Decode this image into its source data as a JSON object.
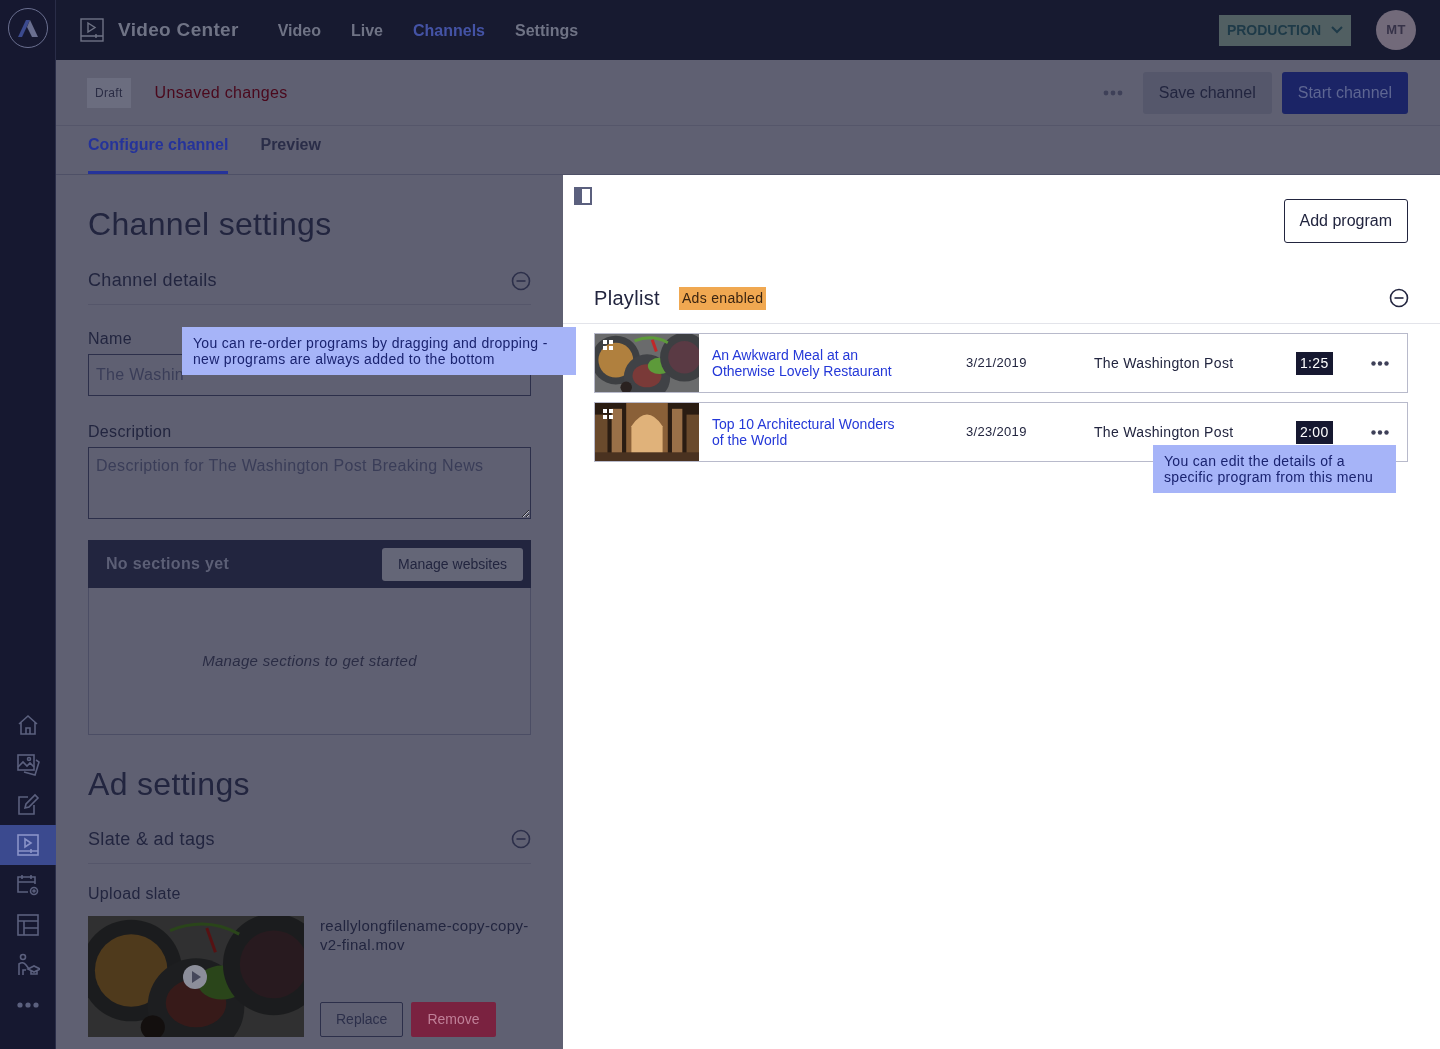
{
  "app": {
    "title": "Video Center"
  },
  "nav": [
    {
      "label": "Video",
      "selected": false
    },
    {
      "label": "Live",
      "selected": false
    },
    {
      "label": "Channels",
      "selected": true
    },
    {
      "label": "Settings",
      "selected": false
    }
  ],
  "environment": {
    "label": "PRODUCTION"
  },
  "avatar": {
    "initials": "MT"
  },
  "rail": [
    {
      "kind": "home",
      "selected": false
    },
    {
      "kind": "images",
      "selected": false
    },
    {
      "kind": "edit",
      "selected": false
    },
    {
      "kind": "video",
      "selected": true
    },
    {
      "kind": "schedule",
      "selected": false
    },
    {
      "kind": "layout",
      "selected": false
    },
    {
      "kind": "learn",
      "selected": false
    },
    {
      "kind": "more",
      "selected": false
    }
  ],
  "toolbar": {
    "status": "Draft",
    "message": "Unsaved changes",
    "save": "Save channel",
    "start": "Start channel"
  },
  "tabs": [
    {
      "label": "Configure channel",
      "selected": true
    },
    {
      "label": "Preview",
      "selected": false
    }
  ],
  "channel_settings": {
    "title": "Channel settings",
    "section": "Channel details",
    "name_label": "Name",
    "name_value": "The Washin",
    "description_label": "Description",
    "description_placeholder": "Description for The Washington Post Breaking News",
    "sections_title": "No sections yet",
    "manage_button": "Manage websites",
    "sections_empty": "Manage sections to get started"
  },
  "ad_settings": {
    "title": "Ad settings",
    "section": "Slate & ad tags",
    "upload_label": "Upload slate",
    "filename": "reallylongfilename-copy-copy-v2-final.mov",
    "replace": "Replace",
    "remove": "Remove"
  },
  "playlist": {
    "add_button": "Add program",
    "title": "Playlist",
    "badge": "Ads enabled",
    "rows": [
      {
        "title": "An Awkward Meal at an Otherwise Lovely Restaurant",
        "date": "3/21/2019",
        "source": "The Washington Post",
        "duration": "1:25"
      },
      {
        "title": "Top 10 Architectural Wonders of the World",
        "date": "3/23/2019",
        "source": "The Washington Post",
        "duration": "2:00"
      }
    ]
  },
  "tips": [
    "You can re-order programs by dragging and dropping - new programs are always added to the bottom",
    "You can edit the details of a specific program from this menu"
  ]
}
